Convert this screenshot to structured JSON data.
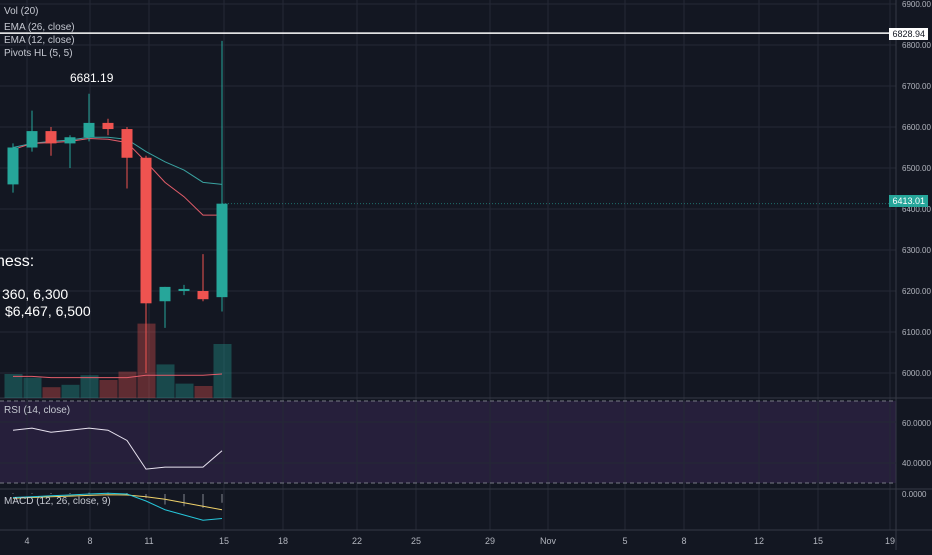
{
  "colors": {
    "background": "#131722",
    "grid": "#242836",
    "text": "#b2b5be",
    "up": "#26a69a",
    "down": "#ef5350",
    "ema12": "#e35d6a",
    "ema26": "#3aa2a0",
    "rsi_band": "#2a2140",
    "rsi_line": "#e8e3f0",
    "macd_line": "#26c6da",
    "signal_line": "#f0d26a",
    "current_price_bg": "#26a69a",
    "high_line": "#ffffff"
  },
  "legend": {
    "vol": "Vol (20)",
    "ema26": "EMA (26, close)",
    "ema12": "EMA (12, close)",
    "pivots": "Pivots HL (5, 5)",
    "rsi": "RSI (14, close)",
    "macd": "MACD (12, 26, close, 9)"
  },
  "annotations": {
    "pivot_high": "6681.19",
    "overlay_line1": "ness:",
    "overlay_line2": "360, 6,300",
    "overlay_line3": "$6,467, 6,500"
  },
  "price_axis": {
    "ticks": [
      "6900.00",
      "6800.00",
      "6700.00",
      "6600.00",
      "6500.00",
      "6400.00",
      "6300.00",
      "6200.00",
      "6100.00",
      "6000.00"
    ],
    "horizontal_line_label": "6828.94",
    "current_price_label": "6413.01"
  },
  "rsi_axis": {
    "ticks": [
      "60.0000",
      "40.0000"
    ]
  },
  "macd_axis": {
    "ticks": [
      "0.0000"
    ]
  },
  "time_axis": {
    "ticks": [
      "4",
      "8",
      "11",
      "15",
      "18",
      "22",
      "25",
      "29",
      "Nov",
      "5",
      "8",
      "12",
      "15",
      "19"
    ]
  },
  "chart_data": {
    "type": "candlestick",
    "price_range": [
      5950,
      6900
    ],
    "horizontal_line": 6828.94,
    "current_price": 6413.01,
    "candles": [
      {
        "o": 6460,
        "h": 6560,
        "l": 6440,
        "c": 6550
      },
      {
        "o": 6550,
        "h": 6640,
        "l": 6540,
        "c": 6590
      },
      {
        "o": 6590,
        "h": 6600,
        "l": 6530,
        "c": 6560
      },
      {
        "o": 6560,
        "h": 6580,
        "l": 6500,
        "c": 6575
      },
      {
        "o": 6575,
        "h": 6681.19,
        "l": 6565,
        "c": 6610
      },
      {
        "o": 6610,
        "h": 6620,
        "l": 6580,
        "c": 6595
      },
      {
        "o": 6595,
        "h": 6600,
        "l": 6450,
        "c": 6525
      },
      {
        "o": 6525,
        "h": 6530,
        "l": 6000,
        "c": 6170
      },
      {
        "o": 6175,
        "h": 6210,
        "l": 6110,
        "c": 6210
      },
      {
        "o": 6200,
        "h": 6215,
        "l": 6190,
        "c": 6205
      },
      {
        "o": 6200,
        "h": 6290,
        "l": 6175,
        "c": 6180
      },
      {
        "o": 6185,
        "h": 6810,
        "l": 6150,
        "c": 6413.01
      }
    ],
    "volume": [
      {
        "v": 0.2,
        "up": true
      },
      {
        "v": 0.17,
        "up": true
      },
      {
        "v": 0.09,
        "up": false
      },
      {
        "v": 0.11,
        "up": true
      },
      {
        "v": 0.19,
        "up": true
      },
      {
        "v": 0.15,
        "up": false
      },
      {
        "v": 0.22,
        "up": false
      },
      {
        "v": 0.62,
        "up": false
      },
      {
        "v": 0.28,
        "up": true
      },
      {
        "v": 0.12,
        "up": true
      },
      {
        "v": 0.1,
        "up": false
      },
      {
        "v": 0.45,
        "up": true
      }
    ],
    "volume_ma": [
      0.18,
      0.18,
      0.17,
      0.17,
      0.17,
      0.17,
      0.17,
      0.19,
      0.19,
      0.19,
      0.19,
      0.2
    ],
    "ema12": [
      6545,
      6560,
      6562,
      6565,
      6572,
      6570,
      6562,
      6515,
      6465,
      6430,
      6385,
      6385
    ],
    "ema26": [
      6550,
      6560,
      6565,
      6568,
      6575,
      6575,
      6570,
      6540,
      6515,
      6495,
      6465,
      6460
    ],
    "rsi": [
      56,
      57,
      55,
      56,
      57,
      56,
      51,
      37,
      38,
      38,
      38,
      46
    ],
    "rsi_range": [
      30,
      72
    ],
    "macd": [
      -10,
      -8,
      -5,
      -3,
      0,
      2,
      0,
      -20,
      -45,
      -60,
      -75,
      -70
    ],
    "signal": [
      -12,
      -10,
      -8,
      -6,
      -4,
      -2,
      -3,
      -8,
      -15,
      -25,
      -35,
      -45
    ],
    "macd_range": [
      -100,
      10
    ]
  }
}
